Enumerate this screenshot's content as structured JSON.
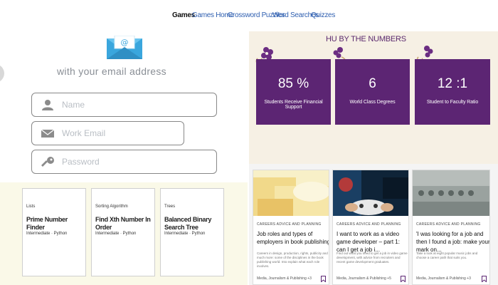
{
  "nav": {
    "items": [
      "Games",
      "Games Home",
      "Crossword Puzzles",
      "Word Searches",
      "Quizzes"
    ],
    "active": "Games"
  },
  "signup": {
    "heading": "with your email address",
    "fields": [
      {
        "placeholder": "Name",
        "icon": "user-icon"
      },
      {
        "placeholder": "Work Email",
        "icon": "mail-icon"
      },
      {
        "placeholder": "Password",
        "icon": "key-icon"
      }
    ]
  },
  "algo_cards": [
    {
      "category": "Lists",
      "title": "Prime Number Finder",
      "meta": "Intermediate · Python"
    },
    {
      "category": "Sorting Algorithm",
      "title": "Find Xth Number In Order",
      "meta": "Intermediate · Python"
    },
    {
      "category": "Trees",
      "title": "Balanced Binary Search Tree",
      "meta": "Intermediate · Python"
    }
  ],
  "numbers": {
    "title": "HU BY THE NUMBERS",
    "stats": [
      {
        "value": "85 %",
        "label": "Students Receive Financial Support"
      },
      {
        "value": "6",
        "label": "World Class Degrees"
      },
      {
        "value": "12 :1",
        "label": "Student to Faculty Ratio"
      }
    ],
    "colors": {
      "card": "#5c2573",
      "panel": "#f6f0e4"
    }
  },
  "articles": [
    {
      "kicker": "CAREERS ADVICE AND PLANNING",
      "title": "Job roles and types of employers in book publishing",
      "excerpt": "Careers in design, production, rights, publicity and much more: some of the disciplines in the book publishing world. Into explain what each role involves.",
      "tags": "Media, Journalism & Publishing +3"
    },
    {
      "kicker": "CAREERS ADVICE AND PLANNING",
      "title": "I want to work as a video game developer – part 1: can I get a job i...",
      "excerpt": "Find out what you need to get a job in video game development, with advice from recruiters and recent game development graduates.",
      "tags": "Media, Journalism & Publishing +5"
    },
    {
      "kicker": "CAREERS ADVICE AND PLANNING",
      "title": "'I was looking for a job and then I found a job: make your mark on...",
      "excerpt": "Take a look at eight popular music jobs and choose a career path that suits you.",
      "tags": "Media, Journalism & Publishing +3"
    }
  ]
}
